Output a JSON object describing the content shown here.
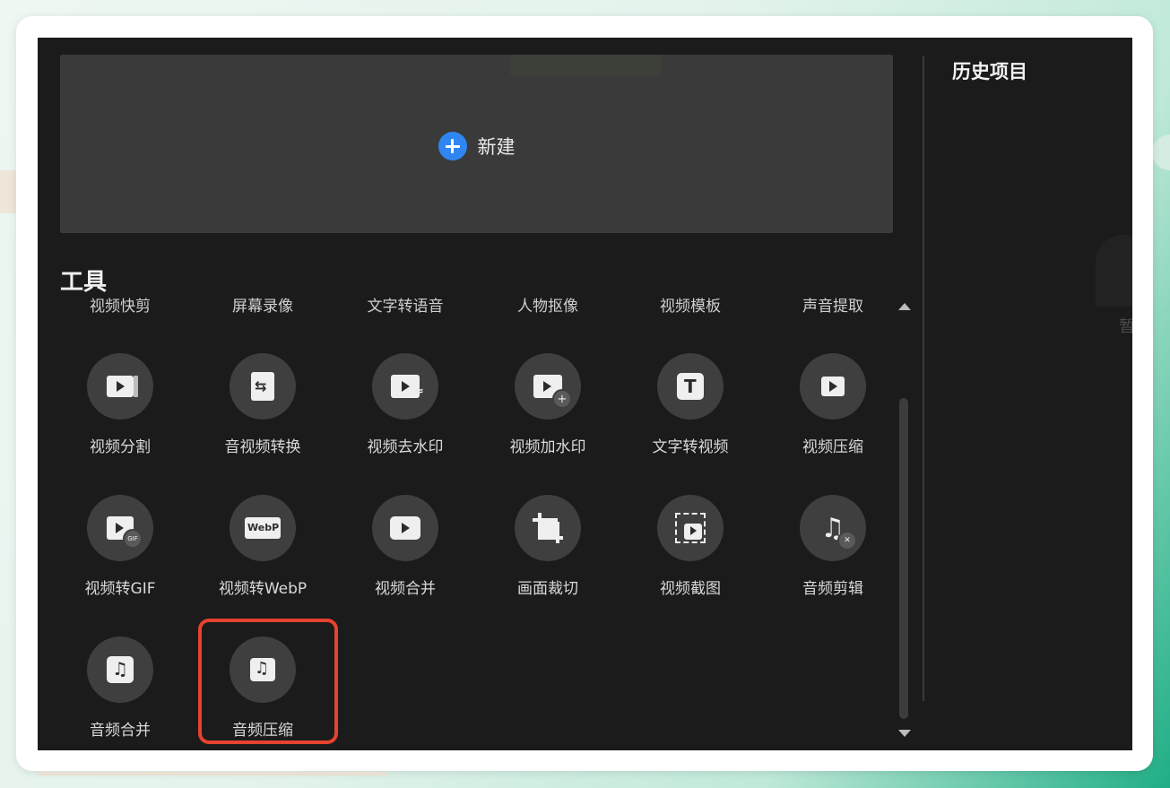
{
  "new_project": {
    "label": "新建",
    "icon": "plus-circle-icon",
    "accent": "#2f86f2"
  },
  "history": {
    "title": "历史项目",
    "faded_text": "暂"
  },
  "tools": {
    "title": "工具",
    "top_row": [
      "视频快剪",
      "屏幕录像",
      "文字转语音",
      "人物抠像",
      "视频模板",
      "声音提取"
    ],
    "items": [
      {
        "label": "视频分割",
        "icon": "video-split-icon"
      },
      {
        "label": "音视频转换",
        "icon": "file-convert-icon"
      },
      {
        "label": "视频去水印",
        "icon": "remove-watermark-icon"
      },
      {
        "label": "视频加水印",
        "icon": "add-watermark-icon"
      },
      {
        "label": "文字转视频",
        "icon": "text-to-video-icon"
      },
      {
        "label": "视频压缩",
        "icon": "video-compress-icon"
      },
      {
        "label": "视频转GIF",
        "icon": "video-to-gif-icon"
      },
      {
        "label": "视频转WebP",
        "icon": "video-to-webp-icon"
      },
      {
        "label": "视频合并",
        "icon": "video-merge-icon"
      },
      {
        "label": "画面裁切",
        "icon": "crop-icon"
      },
      {
        "label": "视频截图",
        "icon": "video-screenshot-icon"
      },
      {
        "label": "音频剪辑",
        "icon": "audio-cut-icon"
      },
      {
        "label": "音频合并",
        "icon": "audio-merge-icon"
      },
      {
        "label": "音频压缩",
        "icon": "audio-compress-icon"
      }
    ],
    "highlighted_item": "音频压缩",
    "highlight_color": "#e7422e"
  },
  "glyphs": {
    "text_tool": "T",
    "gif": "GIF",
    "webp": "WebP",
    "music": "♫",
    "plus": "+",
    "swap": "⇆",
    "wave": "≈"
  }
}
